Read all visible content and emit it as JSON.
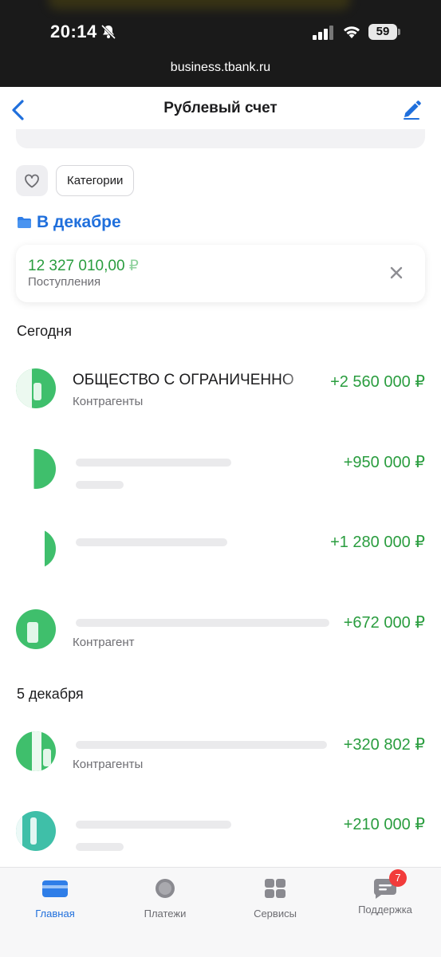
{
  "status_bar": {
    "time": "20:14",
    "battery": "59",
    "url": "business.tbank.ru"
  },
  "nav": {
    "title": "Рублевый счет",
    "back_icon": "chevron-left-icon",
    "edit_icon": "pencil-icon"
  },
  "filters": {
    "favorite_icon": "heart-icon",
    "categories_label": "Категории",
    "period_label": "В декабре"
  },
  "summary": {
    "amount": "12 327 010,00",
    "currency": "₽",
    "label": "Поступления"
  },
  "sections": [
    {
      "title": "Сегодня",
      "transactions": [
        {
          "name": "ОБЩЕСТВО С ОГРАНИЧЕННО",
          "category": "Контрагенты",
          "amount": "+2 560 000 ₽"
        },
        {
          "name": "",
          "category": "",
          "amount": "+950 000 ₽"
        },
        {
          "name": "",
          "category": "",
          "amount": "+1 280 000 ₽"
        },
        {
          "name": "",
          "category": "Контрагент",
          "amount": "+672 000 ₽"
        }
      ]
    },
    {
      "title": "5 декабря",
      "transactions": [
        {
          "name": "",
          "category": "Контрагенты",
          "amount": "+320 802 ₽"
        },
        {
          "name": "",
          "category": "",
          "amount": "+210 000 ₽"
        }
      ]
    }
  ],
  "tabbar": {
    "tabs": [
      {
        "label": "Главная",
        "icon": "card-icon",
        "active": true
      },
      {
        "label": "Платежи",
        "icon": "circle-icon",
        "active": false
      },
      {
        "label": "Сервисы",
        "icon": "grid-icon",
        "active": false
      },
      {
        "label": "Поддержка",
        "icon": "chat-icon",
        "active": false,
        "badge": "7"
      }
    ]
  },
  "colors": {
    "accent": "#1f6fdc",
    "income": "#2a9d3f",
    "avatar": "#3fbf6c",
    "badge": "#f23b3b"
  }
}
